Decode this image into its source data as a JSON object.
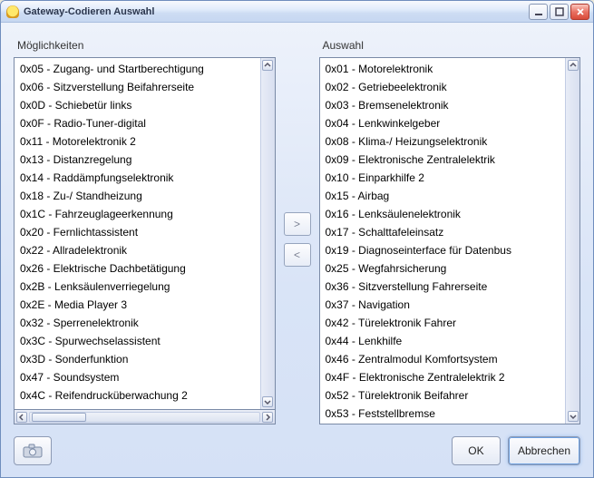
{
  "window": {
    "title": "Gateway-Codieren Auswahl"
  },
  "labels": {
    "available": "Möglichkeiten",
    "selected": "Auswahl"
  },
  "buttons": {
    "move_right": ">",
    "move_left": "<",
    "ok": "OK",
    "cancel": "Abbrechen"
  },
  "icons": {
    "app": "app-icon",
    "minimize": "minimize-icon",
    "maximize": "maximize-icon",
    "close": "close-icon",
    "camera": "camera-icon",
    "scroll_up": "scroll-up-icon",
    "scroll_down": "scroll-down-icon",
    "scroll_left": "scroll-left-icon",
    "scroll_right": "scroll-right-icon"
  },
  "available_items": [
    "0x05 - Zugang- und Startberechtigung",
    "0x06 - Sitzverstellung Beifahrerseite",
    "0x0D - Schiebetür links",
    "0x0F - Radio-Tuner-digital",
    "0x11 - Motorelektronik 2",
    "0x13 - Distanzregelung",
    "0x14 - Raddämpfungselektronik",
    "0x18 - Zu-/ Standheizung",
    "0x1C - Fahrzeuglageerkennung",
    "0x20 - Fernlichtassistent",
    "0x22 - Allradelektronik",
    "0x26 - Elektrische Dachbetätigung",
    "0x2B - Lenksäulenverriegelung",
    "0x2E - Media Player 3",
    "0x32 - Sperrenelektronik",
    "0x3C - Spurwechselassistent",
    "0x3D - Sonderfunktion",
    "0x47 - Soundsystem",
    "0x4C - Reifendrucküberwachung 2"
  ],
  "selected_items": [
    "0x01 - Motorelektronik",
    "0x02 - Getriebeelektronik",
    "0x03 - Bremsenelektronik",
    "0x04 - Lenkwinkelgeber",
    "0x08 - Klima-/ Heizungselektronik",
    "0x09 - Elektronische Zentralelektrik",
    "0x10 - Einparkhilfe 2",
    "0x15 - Airbag",
    "0x16 - Lenksäulenelektronik",
    "0x17 - Schalttafeleinsatz",
    "0x19 - Diagnoseinterface für Datenbus",
    "0x25 - Wegfahrsicherung",
    "0x36 - Sitzverstellung Fahrerseite",
    "0x37 - Navigation",
    "0x42 - Türelektronik Fahrer",
    "0x44 - Lenkhilfe",
    "0x46 - Zentralmodul Komfortsystem",
    "0x4F - Elektronische Zentralelektrik 2",
    "0x52 - Türelektronik Beifahrer",
    "0x53 - Feststellbremse"
  ]
}
